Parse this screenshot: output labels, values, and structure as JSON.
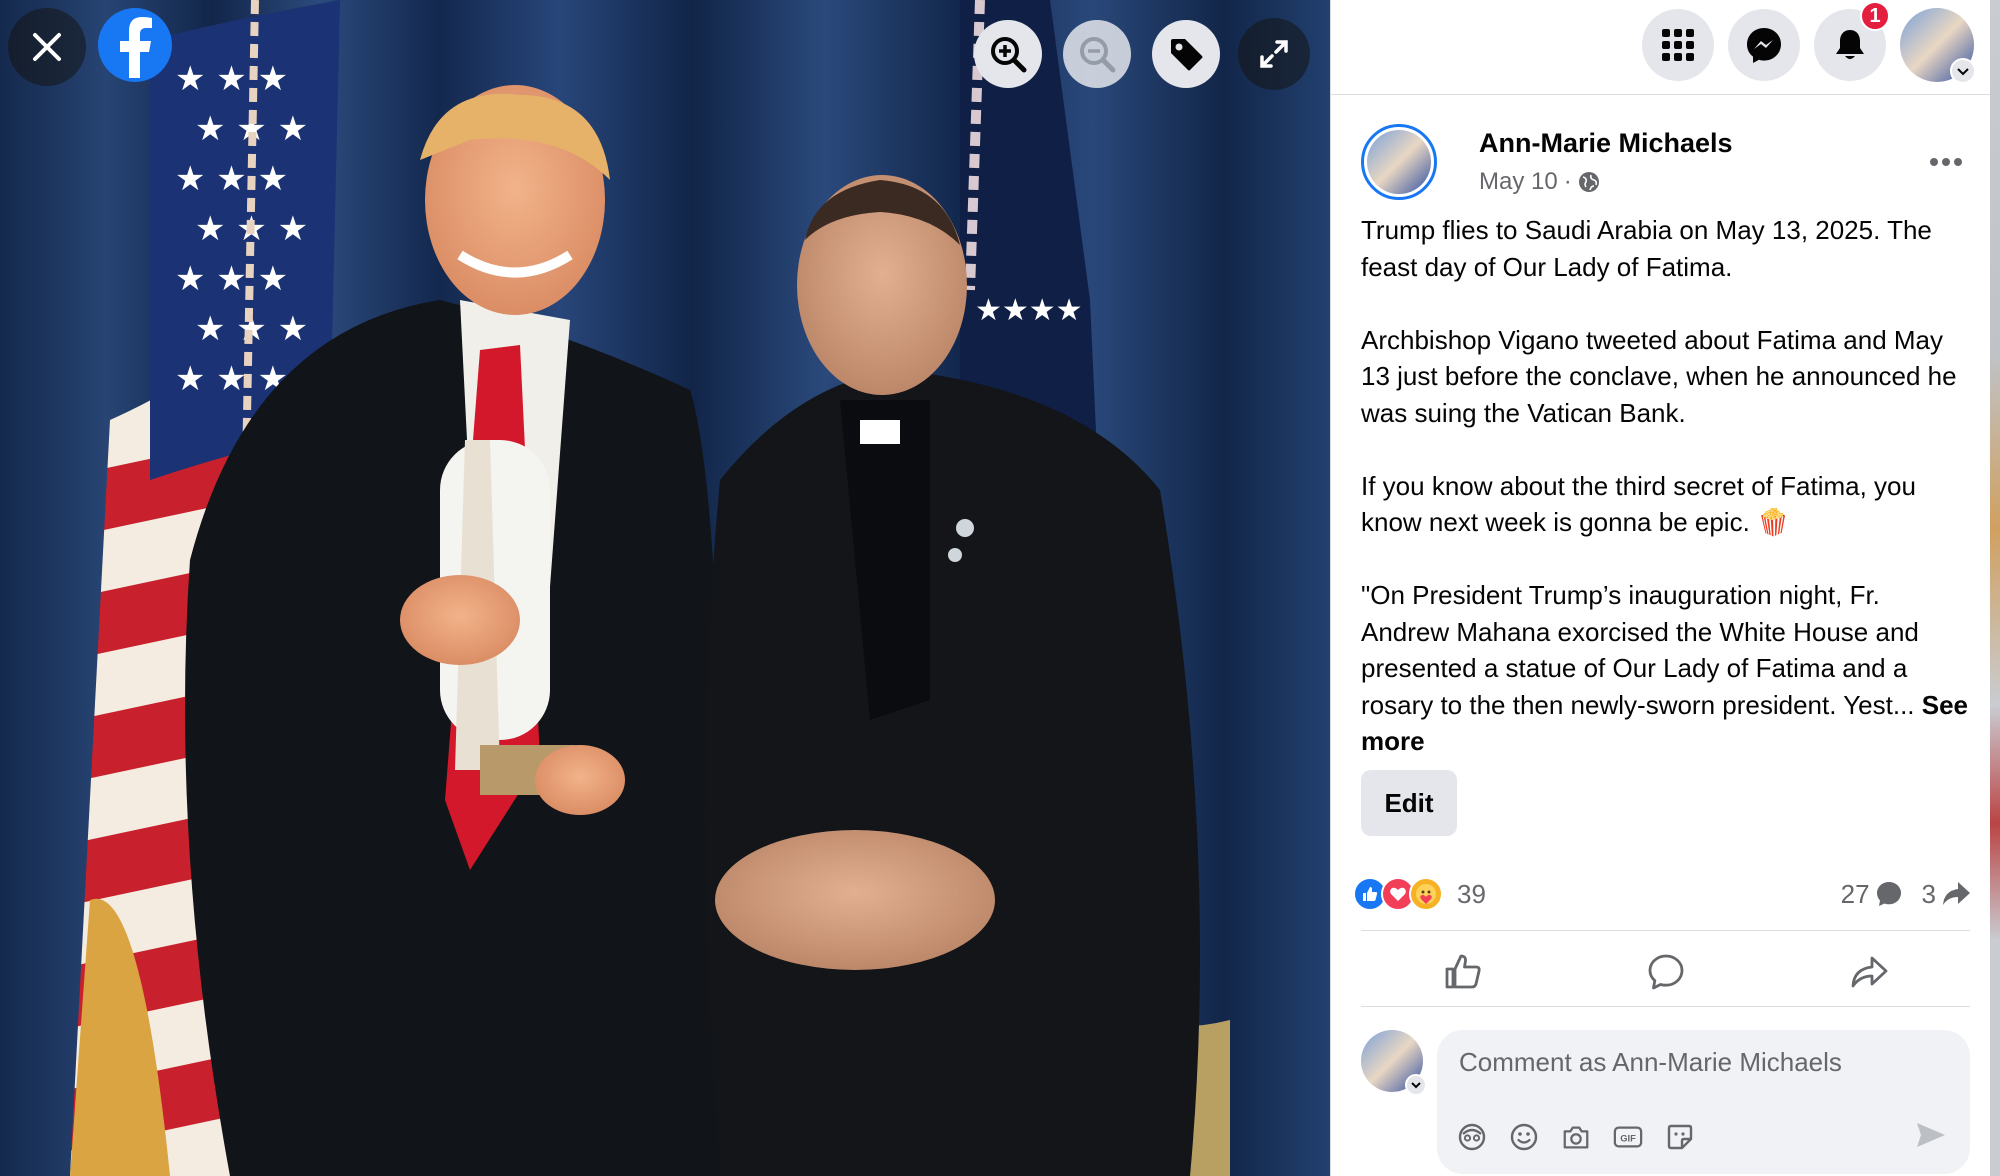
{
  "viewer": {
    "close_icon": "close-icon",
    "logo": "facebook-logo",
    "tools": [
      "zoom-in-icon",
      "zoom-out-icon",
      "tag-icon",
      "fullscreen-icon"
    ]
  },
  "topbar": {
    "menu_icon": "menu-grid-icon",
    "messenger_icon": "messenger-icon",
    "notifications_icon": "bell-icon",
    "notifications_count": "1"
  },
  "post": {
    "author": "Ann-Marie Michaels",
    "date": "May 10",
    "separator": "·",
    "audience_icon": "globe-icon",
    "paragraphs": [
      "Trump flies to Saudi Arabia on May 13, 2025. The feast day of Our Lady of Fatima.",
      "Archbishop Vigano tweeted about Fatima and May 13 just before the conclave, when he announced he was suing the Vatican Bank.",
      "If you know about the third secret of Fatima, you know next week is gonna be epic. 🍿",
      "\"On President Trump’s inauguration night, Fr. Andrew Mahana exorcised the White House and presented a statue of Our Lady of Fatima and a rosary to the then newly-sworn president. Yest..."
    ],
    "see_more": "See more",
    "edit_label": "Edit",
    "reaction_count": "39",
    "comment_count": "27",
    "share_count": "3"
  },
  "comment": {
    "placeholder": "Comment as Ann-Marie Michaels",
    "tools": [
      "avatar-sticker-icon",
      "emoji-icon",
      "camera-icon",
      "gif-icon",
      "sticker-icon"
    ]
  },
  "colors": {
    "accent": "#1877f2",
    "badge": "#e41e3f",
    "secondary_text": "#65676b",
    "button_bg": "#e4e6eb"
  }
}
